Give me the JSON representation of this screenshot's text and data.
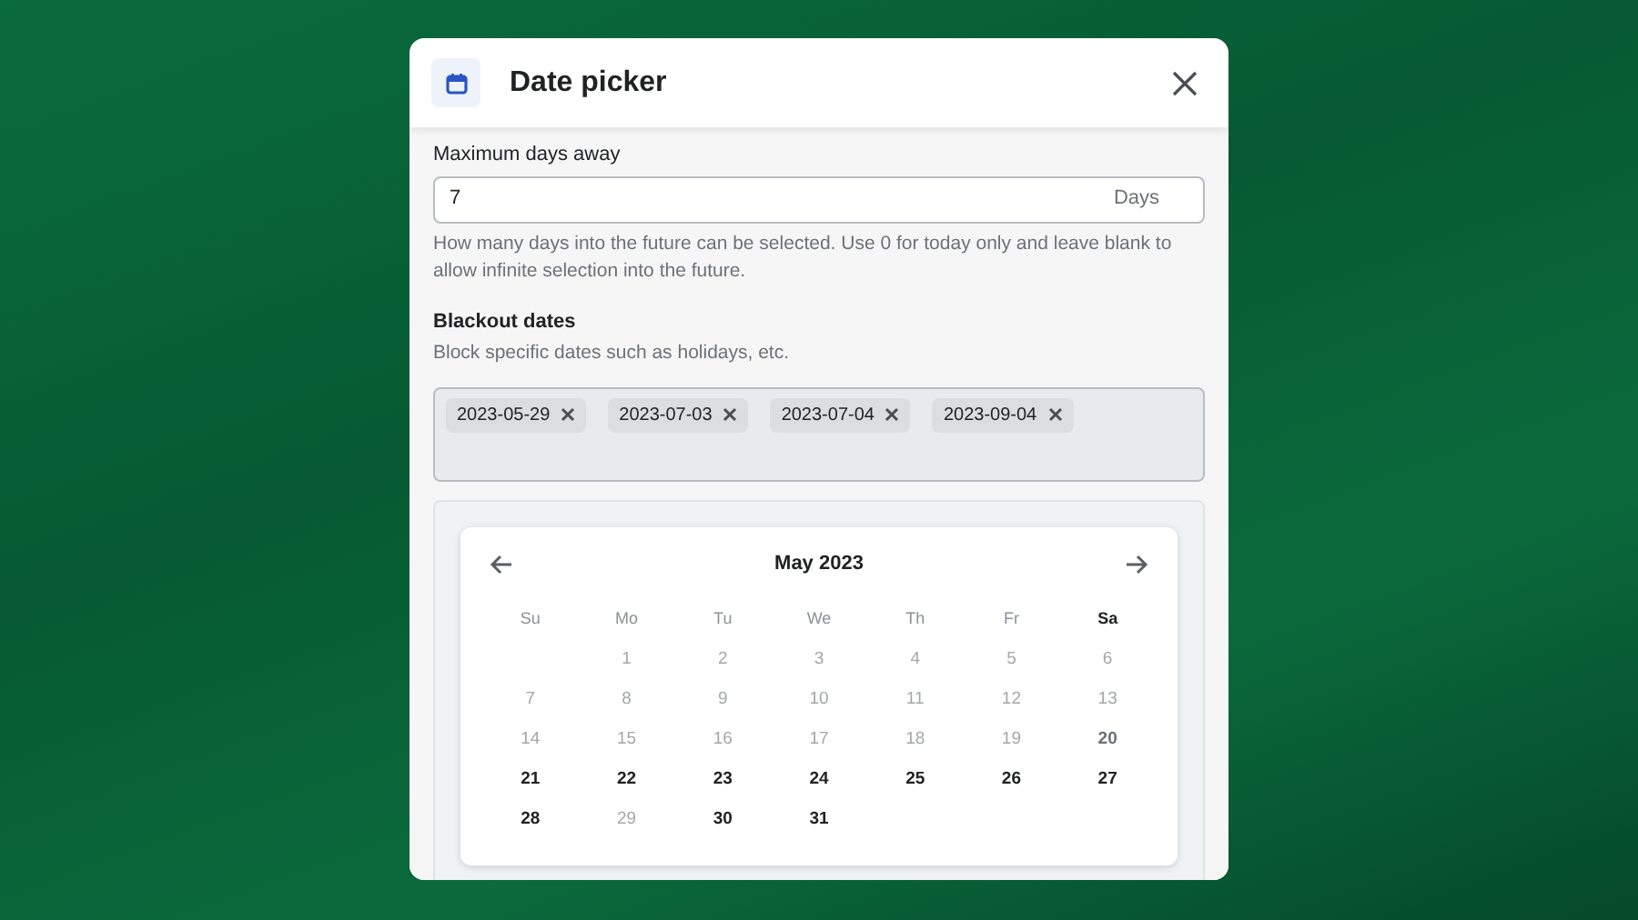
{
  "dialog": {
    "title": "Date picker"
  },
  "max_days": {
    "label": "Maximum days away",
    "value": "7",
    "suffix": "Days",
    "help": "How many days into the future can be selected. Use 0 for today only and leave blank to allow infinite selection into the future."
  },
  "blackout": {
    "label": "Blackout dates",
    "description": "Block specific dates such as holidays, etc.",
    "tags": [
      "2023-05-29",
      "2023-07-03",
      "2023-07-04",
      "2023-09-04"
    ]
  },
  "calendar": {
    "month": "May 2023",
    "weekdays": [
      {
        "label": "Su",
        "selected": false
      },
      {
        "label": "Mo",
        "selected": false
      },
      {
        "label": "Tu",
        "selected": false
      },
      {
        "label": "We",
        "selected": false
      },
      {
        "label": "Th",
        "selected": false
      },
      {
        "label": "Fr",
        "selected": false
      },
      {
        "label": "Sa",
        "selected": true
      }
    ],
    "days": [
      {
        "label": "1",
        "disabled": true,
        "today": false
      },
      {
        "label": "2",
        "disabled": true,
        "today": false
      },
      {
        "label": "3",
        "disabled": true,
        "today": false
      },
      {
        "label": "4",
        "disabled": true,
        "today": false
      },
      {
        "label": "5",
        "disabled": true,
        "today": false
      },
      {
        "label": "6",
        "disabled": true,
        "today": false
      },
      {
        "label": "7",
        "disabled": true,
        "today": false
      },
      {
        "label": "8",
        "disabled": true,
        "today": false
      },
      {
        "label": "9",
        "disabled": true,
        "today": false
      },
      {
        "label": "10",
        "disabled": true,
        "today": false
      },
      {
        "label": "11",
        "disabled": true,
        "today": false
      },
      {
        "label": "12",
        "disabled": true,
        "today": false
      },
      {
        "label": "13",
        "disabled": true,
        "today": false
      },
      {
        "label": "14",
        "disabled": true,
        "today": false
      },
      {
        "label": "15",
        "disabled": true,
        "today": false
      },
      {
        "label": "16",
        "disabled": true,
        "today": false
      },
      {
        "label": "17",
        "disabled": true,
        "today": false
      },
      {
        "label": "18",
        "disabled": true,
        "today": false
      },
      {
        "label": "19",
        "disabled": true,
        "today": false
      },
      {
        "label": "20",
        "disabled": false,
        "today": true
      },
      {
        "label": "21",
        "disabled": false,
        "today": false
      },
      {
        "label": "22",
        "disabled": false,
        "today": false
      },
      {
        "label": "23",
        "disabled": false,
        "today": false
      },
      {
        "label": "24",
        "disabled": false,
        "today": false
      },
      {
        "label": "25",
        "disabled": false,
        "today": false
      },
      {
        "label": "26",
        "disabled": false,
        "today": false
      },
      {
        "label": "27",
        "disabled": false,
        "today": false
      },
      {
        "label": "28",
        "disabled": false,
        "today": false
      },
      {
        "label": "29",
        "disabled": true,
        "today": false
      },
      {
        "label": "30",
        "disabled": false,
        "today": false
      },
      {
        "label": "31",
        "disabled": false,
        "today": false
      }
    ]
  }
}
